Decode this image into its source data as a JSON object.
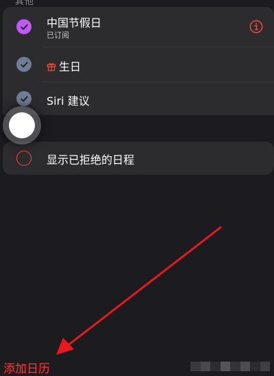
{
  "section": {
    "header": "其他"
  },
  "calendars": [
    {
      "label": "中国节假日",
      "sublabel": "已订阅",
      "checked": true,
      "color": "#bf5af2",
      "icon": "checkmark-icon"
    },
    {
      "label": "生日",
      "checked": true,
      "color": "#6f7d96",
      "icon": "gift-icon"
    },
    {
      "label": "Siri 建议",
      "checked": true,
      "color": "#6f7d96"
    }
  ],
  "declined": {
    "label": "显示已拒绝的日程",
    "checked": false,
    "color": "#ff453a"
  },
  "footer": {
    "add_calendar": "添加日历"
  },
  "colors": {
    "accent": "#ff3b30",
    "background": "#1c1b1f",
    "group_background": "#2c2c2e"
  }
}
